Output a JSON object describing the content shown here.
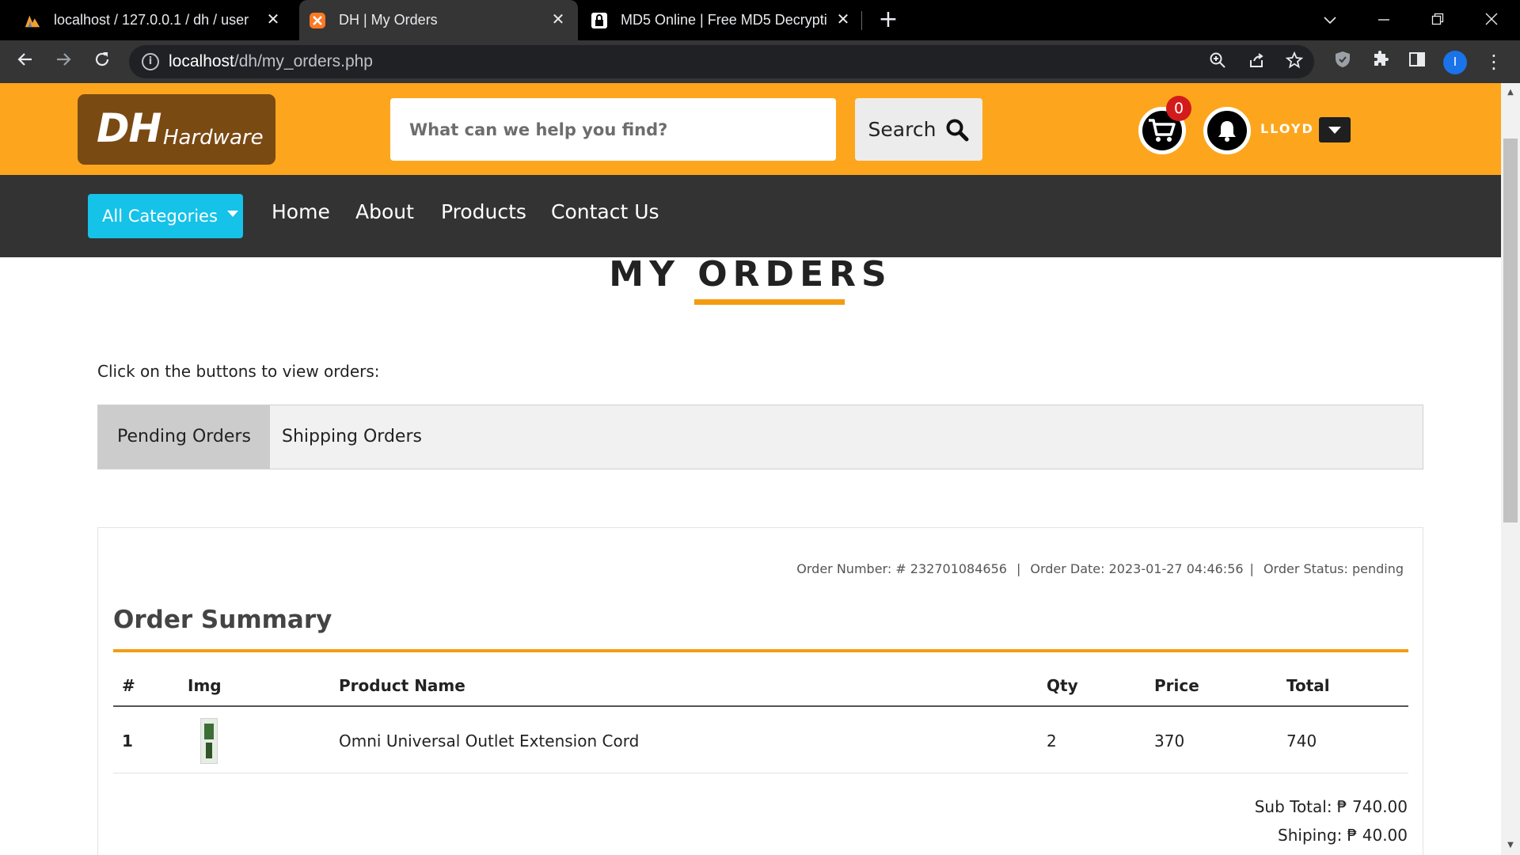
{
  "browser": {
    "tabs": [
      {
        "title": "localhost / 127.0.0.1 / dh / user |",
        "icon": "phpmyadmin-icon"
      },
      {
        "title": "DH | My Orders",
        "icon": "xampp-icon"
      },
      {
        "title": "MD5 Online | Free MD5 Decrypti",
        "icon": "lock-icon"
      }
    ],
    "url_host": "localhost",
    "url_path": "/dh/my_orders.php",
    "profile_initial": "I"
  },
  "site": {
    "logo_big": "DH",
    "logo_small": "Hardware",
    "search_placeholder": "What can we help you find?",
    "search_label": "Search",
    "cart_count": "0",
    "username": "LLOYD",
    "nav": {
      "categories_label": "All Categories",
      "links": [
        "Home",
        "About",
        "Products",
        "Contact Us"
      ]
    }
  },
  "page": {
    "title": "MY ORDERS",
    "instruction": "Click on the buttons to view orders:",
    "tabs": [
      "Pending Orders",
      "Shipping Orders"
    ],
    "order": {
      "number_label": "Order Number: # 232701084656",
      "date_label": "Order Date: 2023-01-27 04:46:56",
      "status_label": "Order Status: pending",
      "summary_title": "Order Summary",
      "columns": [
        "#",
        "Img",
        "Product Name",
        "Qty",
        "Price",
        "Total"
      ],
      "rows": [
        {
          "index": "1",
          "product": "Omni Universal Outlet Extension Cord",
          "qty": "2",
          "price": "370",
          "total": "740"
        }
      ],
      "subtotal": "Sub Total: ₱ 740.00",
      "shipping": "Shiping: ₱ 40.00"
    }
  },
  "colors": {
    "header_orange": "#fda61d",
    "nav_dark": "#333333",
    "accent_cyan": "#15c2e8",
    "logo_brown": "#7a4a13",
    "underline_orange": "#f39c12"
  }
}
